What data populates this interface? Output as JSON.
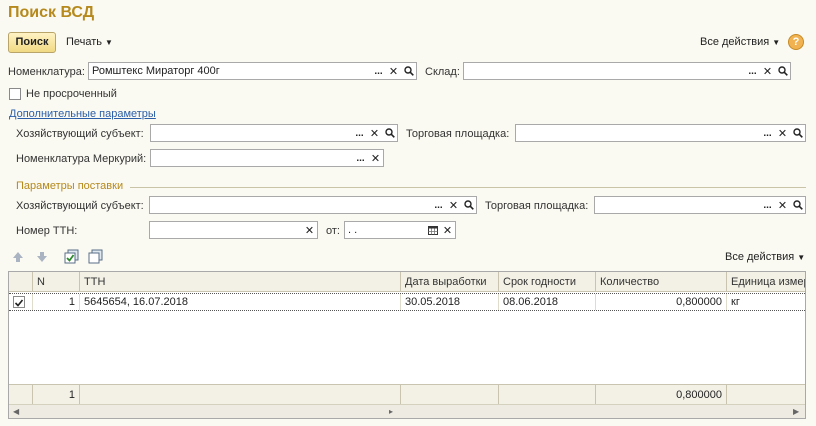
{
  "title": "Поиск ВСД",
  "toolbar": {
    "search_label": "Поиск",
    "print_label": "Печать",
    "all_actions_label": "Все действия",
    "help_label": "?"
  },
  "filters": {
    "nomenclature_label": "Номенклатура:",
    "nomenclature_value": "Ромштекс Мираторг 400г",
    "warehouse_label": "Склад:",
    "warehouse_value": "",
    "not_expired_label": "Не просроченный",
    "not_expired_checked": false,
    "extra_params_link": "Дополнительные параметры",
    "business_entity_label": "Хозяйствующий субъект:",
    "business_entity_value": "",
    "trade_site_label": "Торговая площадка:",
    "trade_site_value": "",
    "mercury_nomenclature_label": "Номенклатура Меркурий:",
    "mercury_nomenclature_value": ""
  },
  "supply": {
    "group_title": "Параметры поставки",
    "business_entity_label": "Хозяйствующий субъект:",
    "business_entity_value": "",
    "trade_site_label": "Торговая площадка:",
    "trade_site_value": "",
    "ttn_number_label": "Номер ТТН:",
    "ttn_number_value": "",
    "date_from_label": "от:",
    "date_from_value": ". ."
  },
  "table": {
    "all_actions_label": "Все действия",
    "columns": [
      "N",
      "ТТН",
      "Дата выработки",
      "Срок годности",
      "Количество",
      "Единица измер"
    ],
    "rows": [
      {
        "checked": true,
        "n": "1",
        "ttn": "5645654, 16.07.2018",
        "production_date": "30.05.2018",
        "expiry_date": "08.06.2018",
        "quantity": "0,800000",
        "unit": "кг"
      }
    ],
    "footer": {
      "count": "1",
      "quantity_total": "0,800000"
    }
  }
}
